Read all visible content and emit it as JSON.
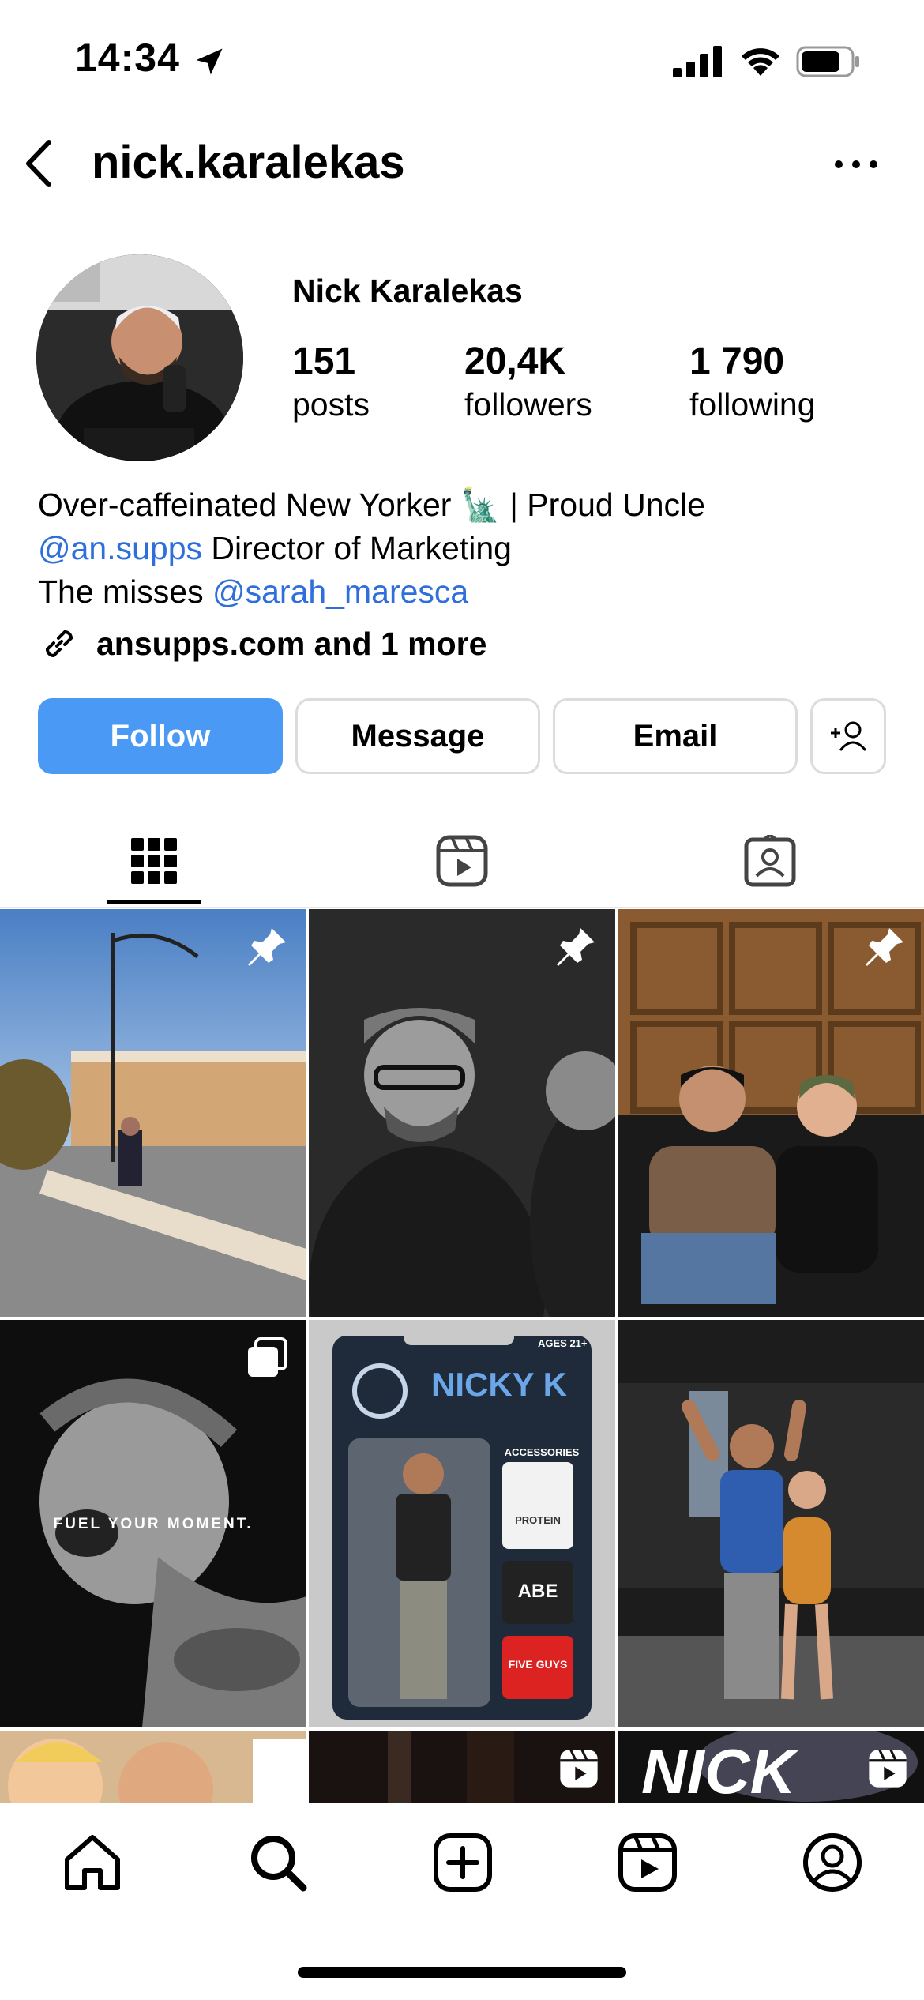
{
  "status_bar": {
    "time": "14:34"
  },
  "header": {
    "username": "nick.karalekas"
  },
  "profile": {
    "display_name": "Nick Karalekas",
    "stats": [
      {
        "value": "151",
        "label": "posts"
      },
      {
        "value": "20,4K",
        "label": "followers"
      },
      {
        "value": "1 790",
        "label": "following"
      }
    ],
    "bio": {
      "line1": "Over-caffeinated New Yorker 🗽 | Proud Uncle",
      "line2_mention": "@an.supps",
      "line2_text": " Director of Marketing",
      "line3_text": "The misses ",
      "line3_mention": "@sarah_maresca"
    },
    "link": "ansupps.com and 1 more"
  },
  "actions": {
    "follow": "Follow",
    "message": "Message",
    "email": "Email"
  },
  "grid": {
    "tile4_text": "FUEL YOUR MOMENT.",
    "tile5_title": "NICKY K",
    "tile5_age": "AGES 21+",
    "tile5_accessories": "ACCESSORIES",
    "tile5_item1": "PROTEIN",
    "tile5_item2": "ABE",
    "tile5_item3": "FIVE GUYS",
    "tile9_text": "NICK"
  },
  "colors": {
    "accent": "#4a9af5",
    "mention": "#2f6fdc"
  },
  "icons": [
    "location-arrow-icon",
    "signal-icon",
    "wifi-icon",
    "battery-icon",
    "back-icon",
    "more-icon",
    "link-icon",
    "add-user-icon",
    "grid-icon",
    "reels-icon",
    "tagged-icon",
    "pin-icon",
    "carousel-icon",
    "home-icon",
    "search-icon",
    "create-icon",
    "profile-icon"
  ]
}
